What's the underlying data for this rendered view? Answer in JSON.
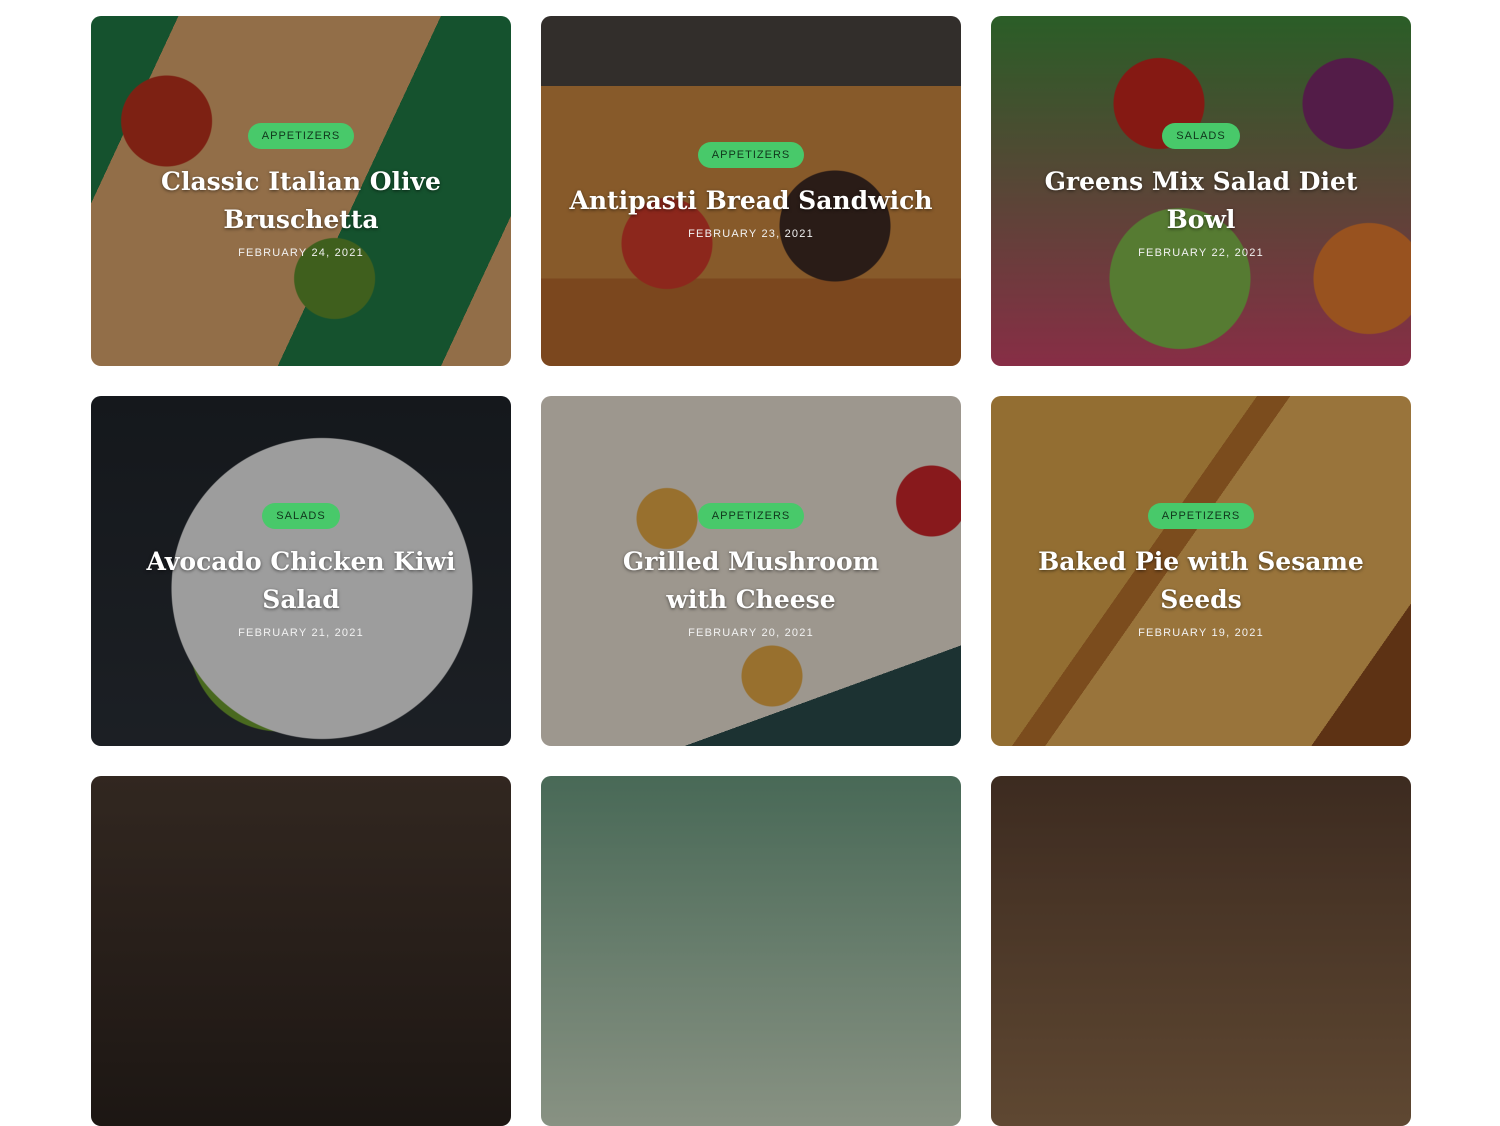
{
  "posts": [
    {
      "category": "APPETIZERS",
      "title": "Classic Italian Olive Bruschetta",
      "date": "FEBRUARY 24, 2021"
    },
    {
      "category": "APPETIZERS",
      "title": "Antipasti Bread Sandwich",
      "date": "FEBRUARY 23, 2021"
    },
    {
      "category": "SALADS",
      "title": "Greens Mix Salad Diet Bowl",
      "date": "FEBRUARY 22, 2021"
    },
    {
      "category": "SALADS",
      "title": "Avocado Chicken Kiwi Salad",
      "date": "FEBRUARY 21, 2021"
    },
    {
      "category": "APPETIZERS",
      "title": "Grilled Mushroom with Cheese",
      "date": "FEBRUARY 20, 2021"
    },
    {
      "category": "APPETIZERS",
      "title": "Baked Pie with Sesame Seeds",
      "date": "FEBRUARY 19, 2021"
    }
  ],
  "colors": {
    "badge": "#48c96a",
    "title": "#ffffff"
  }
}
